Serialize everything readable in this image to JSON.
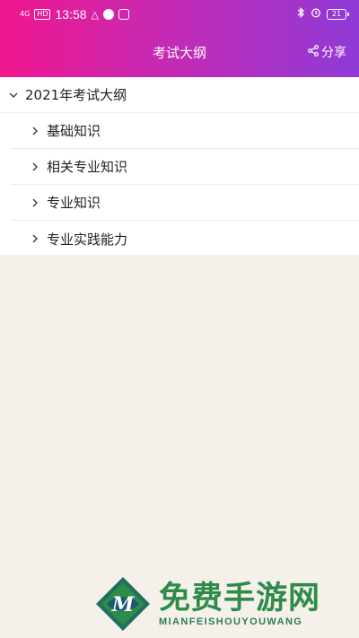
{
  "status_bar": {
    "network": "4G",
    "hd_label": "HD",
    "time": "13:58",
    "battery_level": "21"
  },
  "header": {
    "title": "考试大纲",
    "share_label": "分享"
  },
  "outline": {
    "root": "2021年考试大纲",
    "items": [
      {
        "label": "基础知识"
      },
      {
        "label": "相关专业知识"
      },
      {
        "label": "专业知识"
      },
      {
        "label": "专业实践能力"
      }
    ]
  },
  "watermark": {
    "cn": "免费手游网",
    "en": "MIANFEISHOUYOUWANG",
    "logo_letter": "M"
  },
  "colors": {
    "header_gradient_start": "#f0168d",
    "header_gradient_end": "#8f3ad7",
    "background": "#f5f1ea",
    "watermark_green": "#2e8b4a"
  }
}
